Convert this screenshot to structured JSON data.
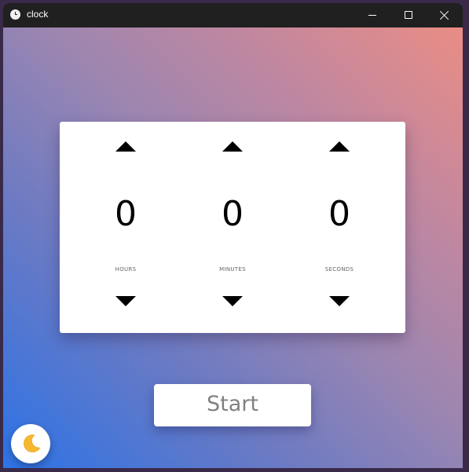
{
  "window": {
    "title": "clock",
    "icons": {
      "app": "clock-icon",
      "minimize": "minimize-icon",
      "maximize": "maximize-icon",
      "close": "close-icon"
    }
  },
  "timer": {
    "columns": [
      {
        "value": "0",
        "unit": "HOURS"
      },
      {
        "value": "0",
        "unit": "MINUTES"
      },
      {
        "value": "0",
        "unit": "SECONDS"
      }
    ],
    "increment_icon": "triangle-up-icon",
    "decrement_icon": "triangle-down-icon"
  },
  "start_button": {
    "label": "Start"
  },
  "theme_toggle": {
    "icon": "moon-icon",
    "color": "#f5b82e"
  },
  "colors": {
    "gradient_start": "#2d73e6",
    "gradient_end": "#ea8d85",
    "card": "#ffffff",
    "start_text": "#808080"
  }
}
